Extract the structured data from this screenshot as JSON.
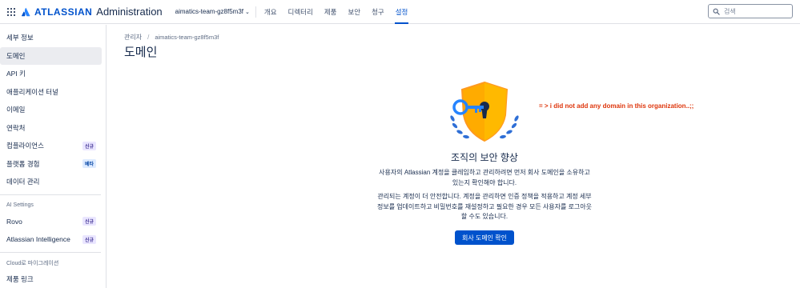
{
  "header": {
    "logo_text": "ATLASSIAN",
    "product": "Administration",
    "org_name": "aimatics-team-gz8f5m3f",
    "nav": [
      {
        "label": "개요"
      },
      {
        "label": "디렉터리"
      },
      {
        "label": "제품"
      },
      {
        "label": "보안"
      },
      {
        "label": "청구"
      },
      {
        "label": "설정",
        "active": true
      }
    ],
    "search_placeholder": "검색"
  },
  "sidebar": {
    "items": [
      {
        "label": "세부 정보"
      },
      {
        "label": "도메인",
        "active": true
      },
      {
        "label": "API 키"
      },
      {
        "label": "애플리케이션 터널"
      },
      {
        "label": "이메일"
      },
      {
        "label": "연락처"
      },
      {
        "label": "컴플라이언스",
        "badge": "신규"
      },
      {
        "label": "플랫폼 경험",
        "badge": "베타"
      },
      {
        "label": "데이터 관리"
      }
    ],
    "ai_heading": "AI Settings",
    "ai_items": [
      {
        "label": "Rovo",
        "badge": "신규"
      },
      {
        "label": "Atlassian Intelligence",
        "badge": "신규"
      }
    ],
    "cloud_heading": "Cloud로 마이그레이션",
    "cloud_items": [
      {
        "label": "제품 링크"
      }
    ]
  },
  "main": {
    "breadcrumb": [
      "관리자",
      "aimatics-team-gz8f5m3f"
    ],
    "title": "도메인",
    "annotation": "= > i did not add any domain in this organization..;;",
    "empty_state": {
      "heading": "조직의 보안 향상",
      "desc1": "사용자의 Atlassian 계정을 클레임하고 관리하려면 먼저 회사 도메인을 소유하고 있는지 확인해야 합니다.",
      "desc2": "관리되는 계정이 더 안전합니다. 계정을 관리하면 인증 정책을 적용하고 계정 세부 정보를 업데이트하고 비밀번호를 재설정하고 필요한 경우 모든 사용자를 로그아웃할 수도 있습니다.",
      "button": "회사 도메인 확인"
    }
  },
  "colors": {
    "brand": "#0052cc",
    "shield": "#ffab00",
    "annotation": "#de350b"
  }
}
